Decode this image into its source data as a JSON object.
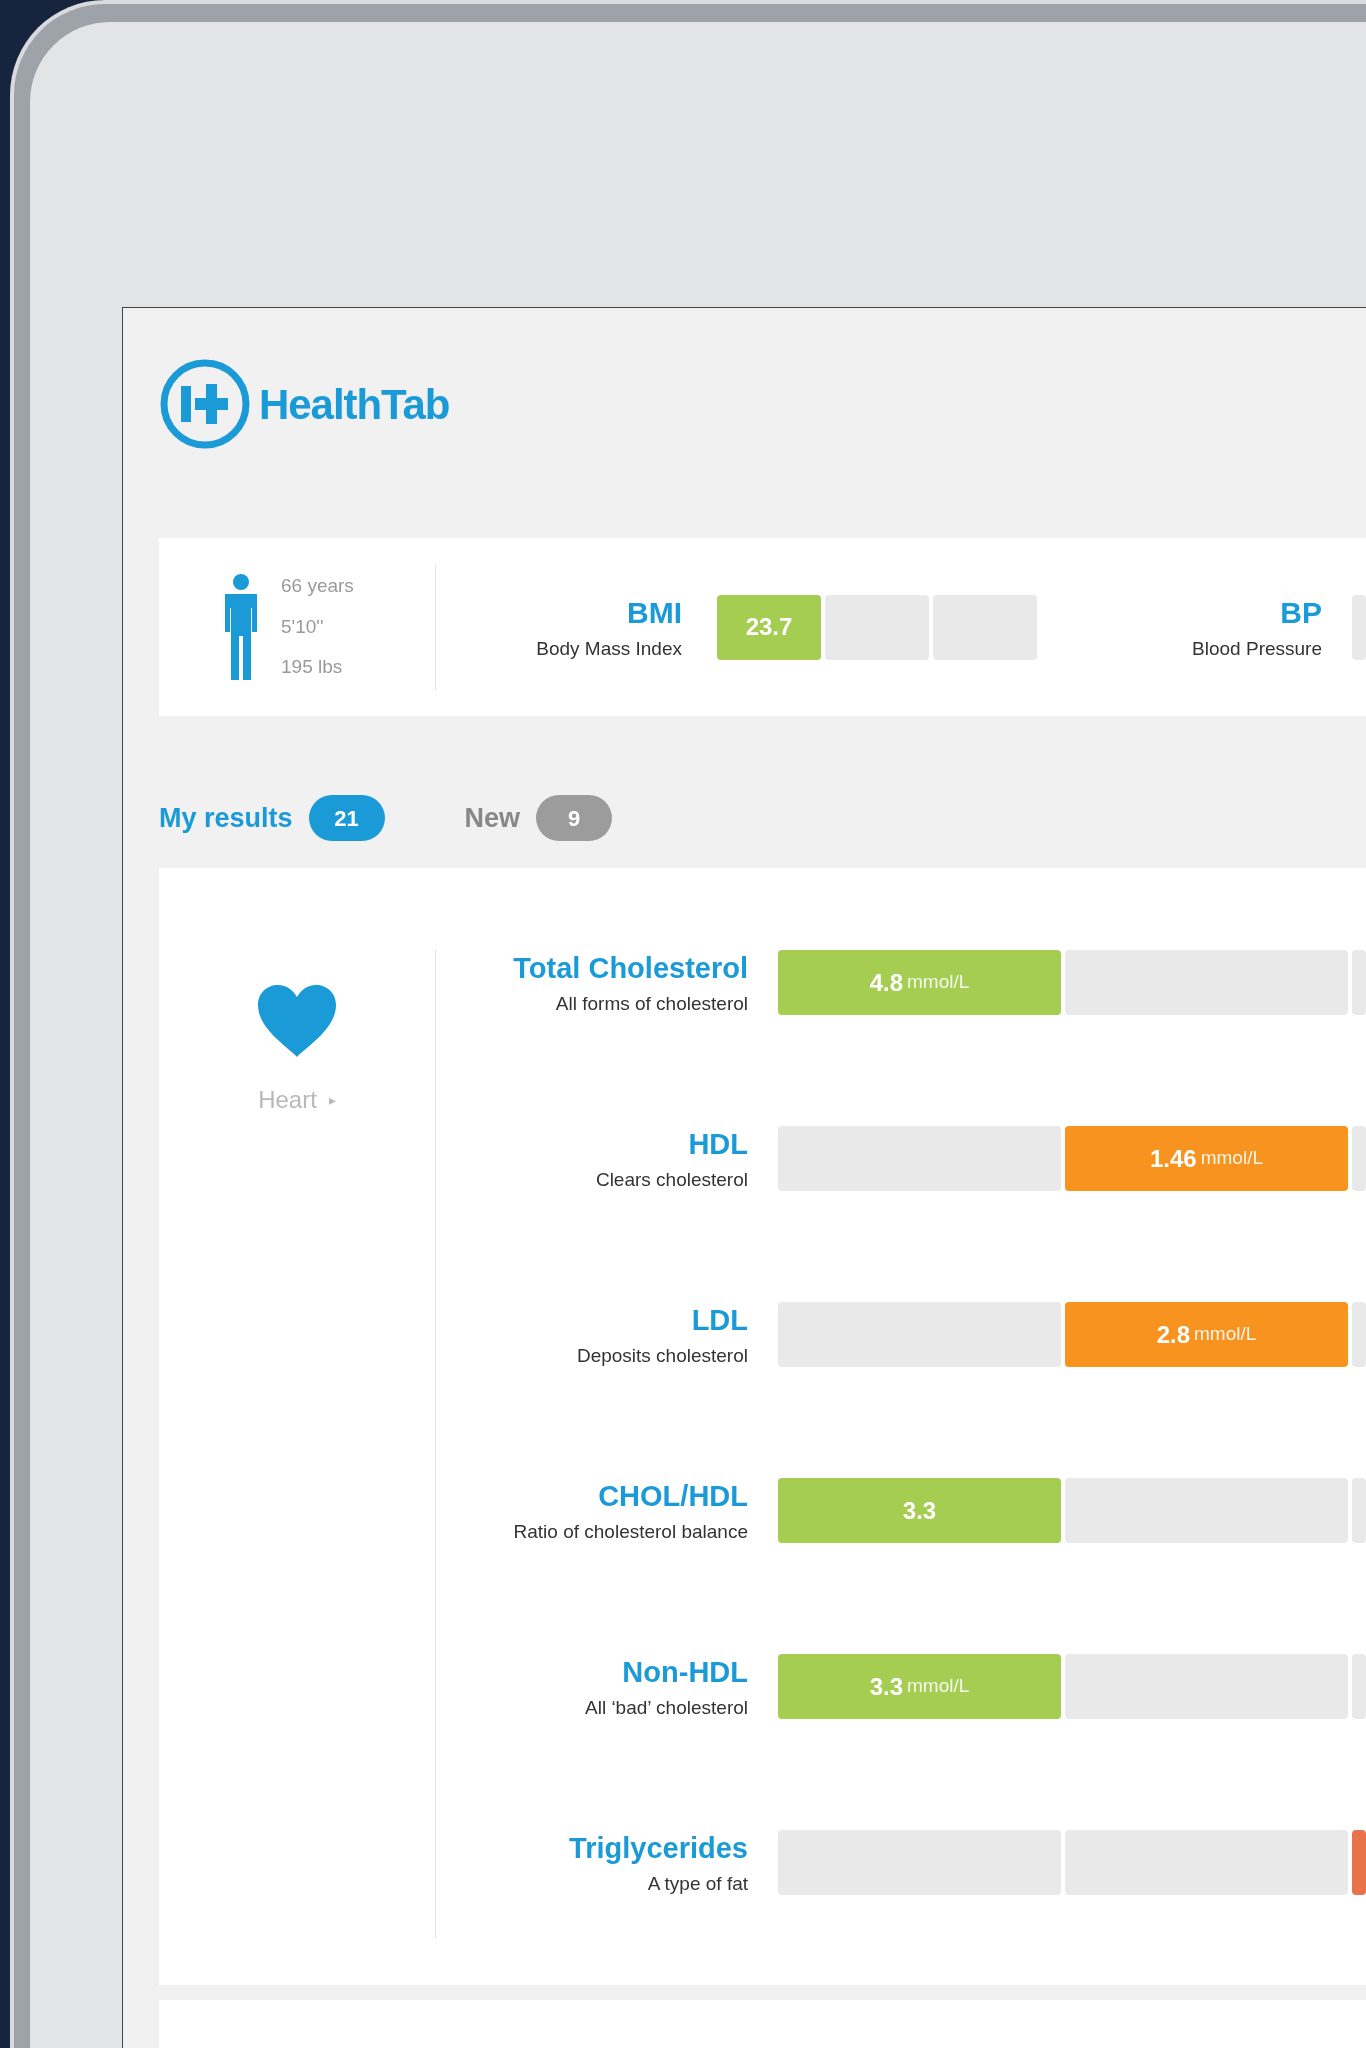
{
  "app": {
    "name": "HealthTab"
  },
  "profile": {
    "lines": [
      "66 years",
      "5'10''",
      "195 lbs"
    ]
  },
  "summary": [
    {
      "title": "BMI",
      "subtitle": "Body Mass Index",
      "segments": [
        {
          "filled": true,
          "value": "23.7",
          "color": "#a5cd52"
        },
        {
          "filled": false
        },
        {
          "filled": false
        }
      ]
    },
    {
      "title": "BP",
      "subtitle": "Blood Pressure"
    }
  ],
  "tabs": [
    {
      "label": "My results",
      "count": "21",
      "selected": true
    },
    {
      "label": "New",
      "count": "9",
      "selected": false
    }
  ],
  "category": {
    "label": "Heart",
    "arrow": "▸"
  },
  "results": [
    {
      "title": "Total Cholesterol",
      "subtitle": "All forms of cholesterol",
      "segments": [
        {
          "filled": true,
          "value": "4.8",
          "unit": "mmol/L",
          "color": "#a5cd52"
        },
        {
          "filled": false
        },
        {
          "filled": false
        }
      ]
    },
    {
      "title": "HDL",
      "subtitle": "Clears cholesterol",
      "segments": [
        {
          "filled": false
        },
        {
          "filled": true,
          "value": "1.46",
          "unit": "mmol/L",
          "color": "#f7931e"
        },
        {
          "filled": false
        }
      ]
    },
    {
      "title": "LDL",
      "subtitle": "Deposits cholesterol",
      "segments": [
        {
          "filled": false
        },
        {
          "filled": true,
          "value": "2.8",
          "unit": "mmol/L",
          "color": "#f7931e"
        },
        {
          "filled": false
        }
      ]
    },
    {
      "title": "CHOL/HDL",
      "subtitle": "Ratio of cholesterol balance",
      "segments": [
        {
          "filled": true,
          "value": "3.3",
          "color": "#a5cd52"
        },
        {
          "filled": false
        },
        {
          "filled": false
        }
      ]
    },
    {
      "title": "Non-HDL",
      "subtitle": "All ‘bad’ cholesterol",
      "segments": [
        {
          "filled": true,
          "value": "3.3",
          "unit": "mmol/L",
          "color": "#a5cd52"
        },
        {
          "filled": false
        },
        {
          "filled": false
        }
      ]
    },
    {
      "title": "Triglycerides",
      "subtitle": "A type of fat",
      "segments": [
        {
          "filled": false
        },
        {
          "filled": false
        },
        {
          "filled": true,
          "color": "#e8734a"
        }
      ]
    }
  ]
}
